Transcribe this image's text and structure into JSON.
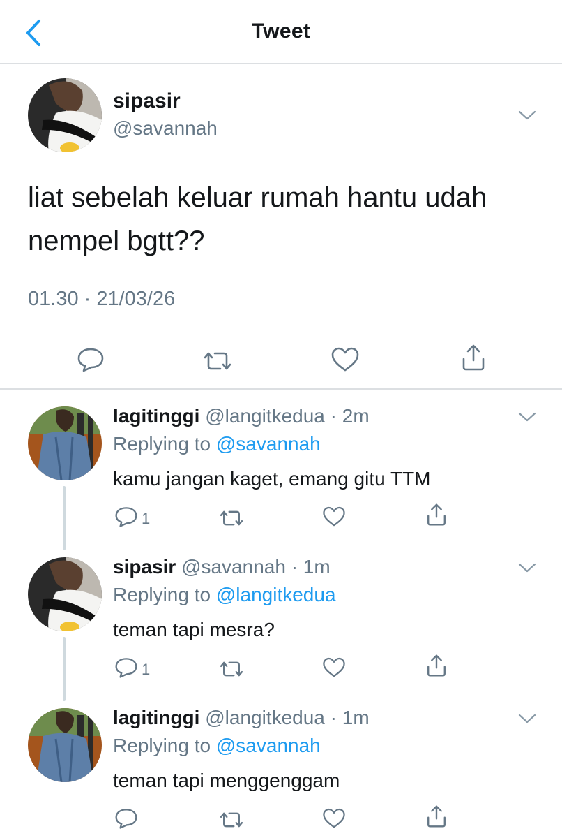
{
  "header": {
    "title": "Tweet"
  },
  "main_tweet": {
    "name": "sipasir",
    "handle": "@savannah",
    "text": "liat sebelah keluar rumah hantu udah nempel bgtt??",
    "timestamp": "01.30 · 21/03/26"
  },
  "replies": [
    {
      "name": "lagitinggi",
      "handle": "@langitkedua · 2m",
      "replying_prefix": "Replying to ",
      "replying_to": "@savannah",
      "text": "kamu jangan kaget, emang gitu TTM",
      "reply_count": "1"
    },
    {
      "name": "sipasir",
      "handle": "@savannah · 1m",
      "replying_prefix": "Replying to ",
      "replying_to": "@langitkedua",
      "text": "teman tapi mesra?",
      "reply_count": "1"
    },
    {
      "name": "lagitinggi",
      "handle": "@langitkedua · 1m",
      "replying_prefix": "Replying to ",
      "replying_to": "@savannah",
      "text": "teman tapi menggenggam",
      "reply_count": ""
    }
  ],
  "colors": {
    "accent": "#1d9bf0",
    "secondary_text": "#657786",
    "divider": "#dcdfe2"
  },
  "icons": [
    "back-chevron-icon",
    "chevron-down-icon",
    "reply-icon",
    "retweet-icon",
    "like-icon",
    "share-icon"
  ]
}
